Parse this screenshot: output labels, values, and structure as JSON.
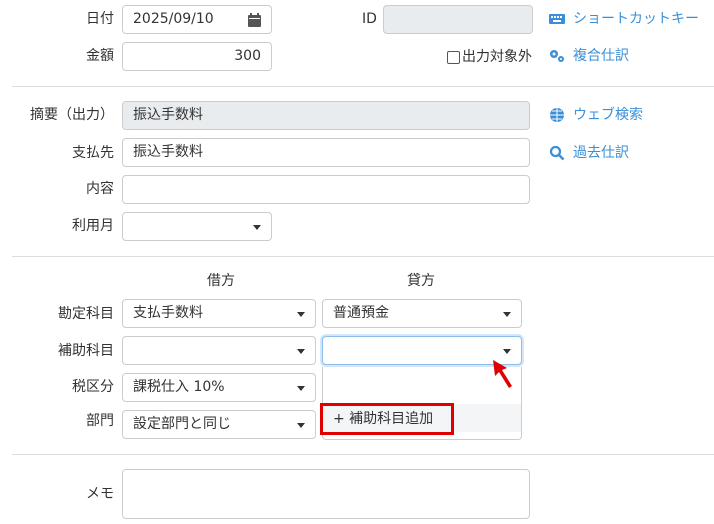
{
  "date": {
    "label": "日付",
    "value": "2025/09/10",
    "icon": "calendar-icon"
  },
  "id": {
    "label": "ID",
    "value": ""
  },
  "amount": {
    "label": "金額",
    "value": "300"
  },
  "exclude_output": {
    "label": "出力対象外",
    "checked": false
  },
  "links": {
    "shortcut": "ショートカットキー",
    "compound": "複合仕訳",
    "web_search": "ウェブ検索",
    "past": "過去仕訳"
  },
  "summary": {
    "label": "摘要（出力）",
    "value": "振込手数料"
  },
  "payee": {
    "label": "支払先",
    "value": "振込手数料"
  },
  "content": {
    "label": "内容",
    "value": ""
  },
  "usage_month": {
    "label": "利用月",
    "value": ""
  },
  "columns": {
    "debit": "借方",
    "credit": "貸方"
  },
  "account": {
    "label": "勘定科目",
    "debit": "支払手数料",
    "credit": "普通預金"
  },
  "sub_account": {
    "label": "補助科目",
    "debit": "",
    "credit": ""
  },
  "tax": {
    "label": "税区分",
    "debit": "課税仕入 10%"
  },
  "dept": {
    "label": "部門",
    "debit": "設定部門と同じ"
  },
  "dropdown": {
    "add_item": "+ 補助科目追加"
  },
  "memo": {
    "label": "メモ",
    "value": ""
  },
  "colors": {
    "link": "#3a8fd8",
    "highlight": "#e00000"
  }
}
